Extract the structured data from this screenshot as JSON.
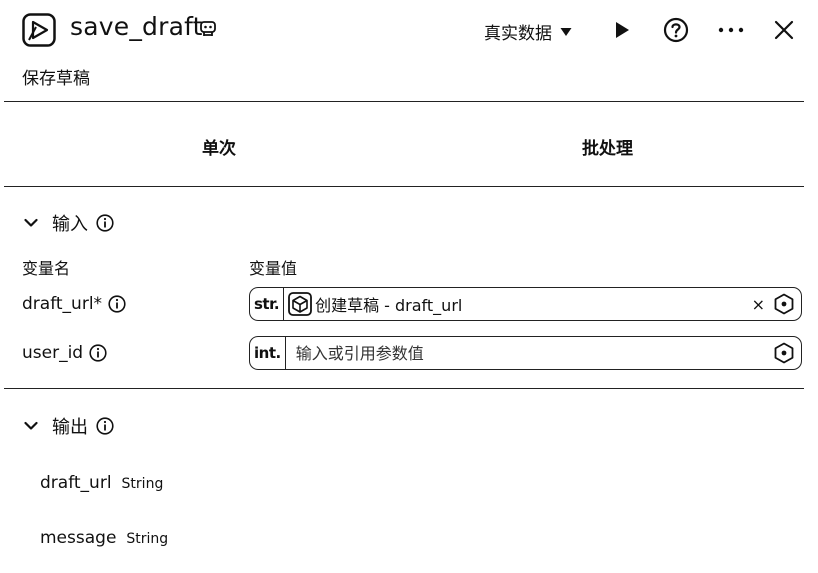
{
  "header": {
    "title": "save_draft",
    "subtitle": "保存草稿",
    "env_select": "真实数据",
    "icons": [
      "app-icon",
      "robot-icon",
      "caret-down-icon",
      "play-icon",
      "help-icon",
      "more-icon",
      "close-icon"
    ]
  },
  "tabs": [
    {
      "label": "单次"
    },
    {
      "label": "批处理"
    }
  ],
  "input_section": {
    "title": "输入",
    "col_name": "变量名",
    "col_value": "变量值",
    "rows": [
      {
        "name": "draft_url*",
        "type": "str.",
        "ref_label": "创建草稿 - draft_url",
        "placeholder": ""
      },
      {
        "name": "user_id",
        "type": "int.",
        "ref_label": "",
        "placeholder": "输入或引用参数值"
      }
    ],
    "clear": "×"
  },
  "output_section": {
    "title": "输出",
    "rows": [
      {
        "name": "draft_url",
        "type": "String"
      },
      {
        "name": "message",
        "type": "String"
      }
    ]
  }
}
